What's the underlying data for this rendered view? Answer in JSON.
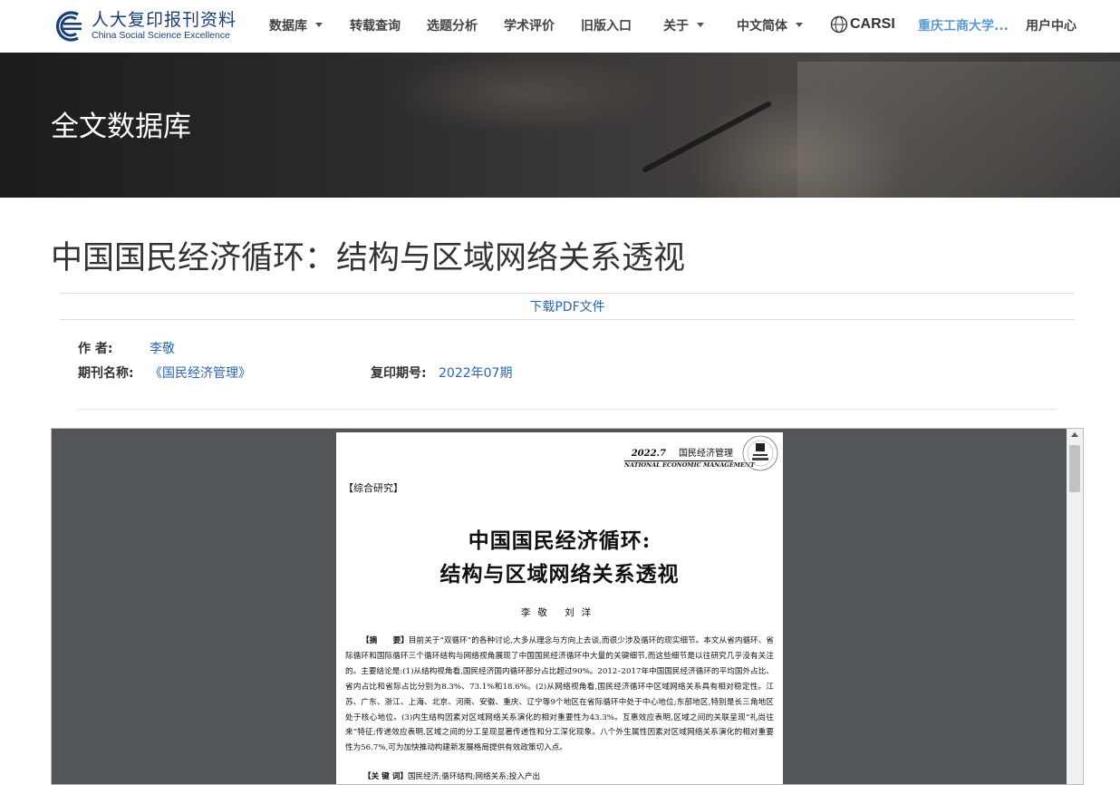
{
  "header": {
    "logo_cn": "人大复印报刊资料",
    "logo_en": "China Social Science Excellence",
    "nav": [
      {
        "label": "数据库",
        "dropdown": true
      },
      {
        "label": "转载查询",
        "dropdown": false
      },
      {
        "label": "选题分析",
        "dropdown": false
      },
      {
        "label": "学术评价",
        "dropdown": false
      },
      {
        "label": "旧版入口",
        "dropdown": false
      },
      {
        "label": "关于",
        "dropdown": true
      },
      {
        "label": "中文简体",
        "dropdown": true
      }
    ],
    "carsi_label": "CARSI",
    "institution": "重庆工商大学...",
    "user_center": "用户中心",
    "colors": {
      "brand": "#1a3e78",
      "link": "#2a66b0",
      "institution": "#5b9bd5"
    }
  },
  "banner": {
    "title": "全文数据库"
  },
  "article": {
    "title": "中国国民经济循环：结构与区域网络关系透视",
    "pdf_link": "下载PDF文件",
    "author_label": "作 者:",
    "author": "李敬",
    "journal_label": "期刊名称:",
    "journal": "《国民经济管理》",
    "issue_label": "复印期号:",
    "issue": "2022年07期"
  },
  "pdf_page": {
    "header_issue": "2022.7",
    "header_journal": "国民经济管理",
    "header_en": "NATIONAL ECONOMIC MANAGEMENT",
    "section_tag": "【综合研究】",
    "title_line1": "中国国民经济循环:",
    "title_line2": "结构与区域网络关系透视",
    "authors": "李敬 刘洋",
    "abstract_label": "【摘　　要】",
    "abstract": "目前关于“双循环”的各种讨论,大多从理念与方向上去谈,而很少涉及循环的现实细节。本文从省内循环、省际循环和国际循环三个循环结构与网络视角展现了中国国民经济循环中大量的关键细节,而这些细节是以往研究几乎没有关注的。主要结论是:(1)从结构视角看,国民经济国内循环部分占比超过90%。2012–2017年中国国民经济循环的平均国外占比、省内占比和省际占比分别为8.3%、73.1%和18.6%。(2)从网络视角看,国民经济循环中区域网络关系具有相对稳定性。江苏、广东、浙江、上海、北京、河南、安徽、重庆、辽宁等9个地区在省际循环中处于中心地位;东部地区,特别是长三角地区处于核心地位。(3)内生结构因素对区域网络关系演化的相对重要性为43.3%。互惠效应表明,区域之间的关联呈现“礼尚往来”特征;传递效应表明,区域之间的分工呈现显著传递性和分工深化现象。八个外生属性因素对区域网络关系演化的相对重要性为56.7%,可为加快推动构建新发展格局提供有效政策切入点。",
    "keywords_label": "【关 键 词】",
    "keywords": "国民经济;循环结构;网络关系;投入产出"
  }
}
